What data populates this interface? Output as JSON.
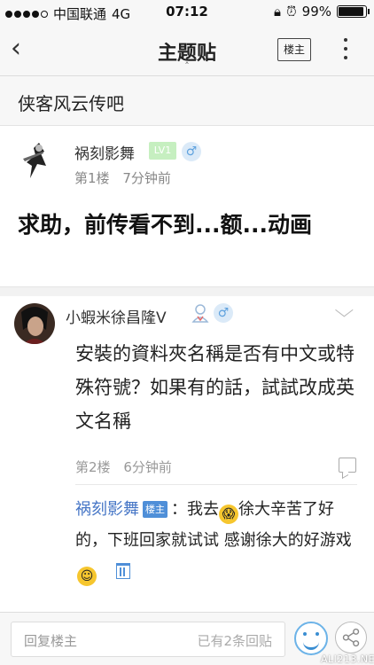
{
  "status": {
    "carrier": "中国联通",
    "network": "4G",
    "time": "07:12",
    "battery": "99%",
    "battery_level": 0.99
  },
  "nav": {
    "back_icon": "chevron-left-icon",
    "title": "主题贴",
    "owner_button": "楼主",
    "more_icon": "more-vertical-icon"
  },
  "forum": {
    "name": "侠客风云传吧"
  },
  "op": {
    "username": "祸刻影舞",
    "level": "LV1",
    "floor": "第1楼",
    "time": "7分钟前",
    "title": "求助，前传看不到...额...动画"
  },
  "reply": {
    "username": "小蝦米徐昌隆V",
    "content": "安裝的資料夾名稱是否有中文或特殊符號？如果有的話，試試改成英文名稱",
    "floor": "第2楼",
    "time": "6分钟前",
    "sub": {
      "username": "祸刻影舞",
      "tag": "楼主",
      "text1": "：我去",
      "text2": "徐大辛苦了好的，下班回家就试试 感谢徐大的好游戏"
    }
  },
  "bottom": {
    "placeholder": "回复楼主",
    "reply_count": "已有2条回贴",
    "watermark": "ALI213.NET"
  },
  "colors": {
    "accent": "#4f8fd8",
    "link": "#4676c6",
    "level_badge": "#c6efc0"
  }
}
